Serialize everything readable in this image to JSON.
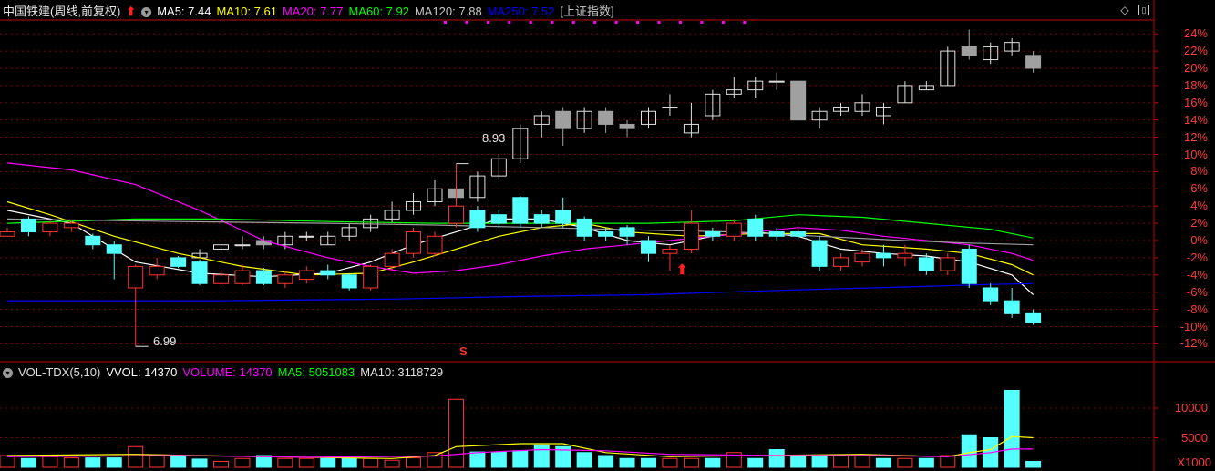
{
  "main_header": {
    "title": "中国铁建(周线,前复权)",
    "ma5_label": "MA5: 7.44",
    "ma10_label": "MA10: 7.61",
    "ma20_label": "MA20: 7.77",
    "ma60_label": "MA60: 7.92",
    "ma120_label": "MA120: 7.88",
    "ma250_label": "MA250: 7.52",
    "index_label": "[上证指数]"
  },
  "vol_header": {
    "title": "VOL-TDX(5,10)",
    "vvol_label": "VVOL: 14370",
    "volume_label": "VOLUME: 14370",
    "ma5_label": "MA5: 5051083",
    "ma10_label": "MA10: 3118729"
  },
  "price_axis_ticks": [
    "24%",
    "22%",
    "20%",
    "18%",
    "16%",
    "14%",
    "12%",
    "10%",
    "8%",
    "6%",
    "4%",
    "2%",
    "0%",
    "-2%",
    "-4%",
    "-6%",
    "-8%",
    "-10%",
    "-12%"
  ],
  "volume_axis_ticks": [
    "10000",
    "5000"
  ],
  "volume_unit": "X1000",
  "annotations": {
    "high": "8.93",
    "low": "6.99",
    "s_marker": "S"
  },
  "colors": {
    "up": "#ff3232",
    "down": "#54ffff",
    "index_up": "#e0e0e0",
    "index_down": "#a0a0a0",
    "ma5": "#ffffff",
    "ma10": "#ffff00",
    "ma20": "#ff00ff",
    "ma60": "#00ff00",
    "ma120": "#a0a0a0",
    "ma250": "#0000ff",
    "grid": "#800000",
    "axis": "#c00000"
  },
  "chart_data": {
    "type": "candlestick",
    "y_axis": "percent change",
    "ylim": [
      -13,
      25
    ],
    "stock_candles": [
      {
        "o": 0.5,
        "c": 1.0,
        "h": 1.5,
        "l": 0.5
      },
      {
        "o": 2.5,
        "c": 1.0,
        "h": 2.8,
        "l": 0.5
      },
      {
        "o": 1.0,
        "c": 2.0,
        "h": 2.3,
        "l": 0.5
      },
      {
        "o": 1.5,
        "c": 2.0,
        "h": 2.4,
        "l": 1.0
      },
      {
        "o": 0.5,
        "c": -0.5,
        "h": 0.8,
        "l": -1.0
      },
      {
        "o": -0.5,
        "c": -1.5,
        "h": 0.0,
        "l": -4.5
      },
      {
        "o": -5.5,
        "c": -3.0,
        "h": -2.8,
        "l": -12.3
      },
      {
        "o": -4.0,
        "c": -3.0,
        "h": -2.0,
        "l": -4.5
      },
      {
        "o": -2.0,
        "c": -3.0,
        "h": -1.8,
        "l": -3.2
      },
      {
        "o": -2.5,
        "c": -5.0,
        "h": -2.2,
        "l": -5.2
      },
      {
        "o": -5.0,
        "c": -4.0,
        "h": -3.5,
        "l": -5.2
      },
      {
        "o": -5.0,
        "c": -3.5,
        "h": -2.8,
        "l": -5.2
      },
      {
        "o": -3.5,
        "c": -5.0,
        "h": -3.2,
        "l": -5.2
      },
      {
        "o": -5.0,
        "c": -4.0,
        "h": -3.5,
        "l": -5.5
      },
      {
        "o": -4.5,
        "c": -3.5,
        "h": -3.0,
        "l": -5.0
      },
      {
        "o": -3.5,
        "c": -4.0,
        "h": -2.8,
        "l": -4.5
      },
      {
        "o": -4.0,
        "c": -5.5,
        "h": -3.8,
        "l": -5.8
      },
      {
        "o": -5.5,
        "c": -3.0,
        "h": -2.8,
        "l": -5.8
      },
      {
        "o": -3.0,
        "c": -1.5,
        "h": -1.0,
        "l": -3.5
      },
      {
        "o": -1.5,
        "c": 1.0,
        "h": 1.5,
        "l": -2.0
      },
      {
        "o": -1.5,
        "c": 0.5,
        "h": 1.0,
        "l": -1.8
      },
      {
        "o": 2.0,
        "c": 4.0,
        "h": 8.93,
        "l": 1.5
      },
      {
        "o": 3.5,
        "c": 1.5,
        "h": 4.0,
        "l": 1.0
      },
      {
        "o": 3.0,
        "c": 2.0,
        "h": 3.5,
        "l": 1.5
      },
      {
        "o": 5.0,
        "c": 2.0,
        "h": 5.2,
        "l": 1.5
      },
      {
        "o": 3.0,
        "c": 2.0,
        "h": 3.5,
        "l": 1.5
      },
      {
        "o": 3.5,
        "c": 2.0,
        "h": 5.0,
        "l": 1.5
      },
      {
        "o": 2.5,
        "c": 0.5,
        "h": 2.8,
        "l": 0.0
      },
      {
        "o": 1.0,
        "c": 0.5,
        "h": 1.5,
        "l": 0.0
      },
      {
        "o": 1.5,
        "c": 0.5,
        "h": 1.8,
        "l": -0.5
      },
      {
        "o": 0.0,
        "c": -1.5,
        "h": 0.5,
        "l": -2.5
      },
      {
        "o": -1.5,
        "c": -1.0,
        "h": -0.5,
        "l": -3.5
      },
      {
        "o": -1.0,
        "c": 2.0,
        "h": 3.5,
        "l": -1.5
      },
      {
        "o": 1.0,
        "c": 0.5,
        "h": 1.5,
        "l": 0.0
      },
      {
        "o": 0.5,
        "c": 2.0,
        "h": 2.5,
        "l": 0.0
      },
      {
        "o": 2.5,
        "c": 0.5,
        "h": 3.0,
        "l": 0.0
      },
      {
        "o": 1.0,
        "c": 0.5,
        "h": 1.5,
        "l": 0.0
      },
      {
        "o": 1.0,
        "c": 0.5,
        "h": 1.3,
        "l": 0.2
      },
      {
        "o": 0.0,
        "c": -3.0,
        "h": 0.5,
        "l": -3.5
      },
      {
        "o": -3.0,
        "c": -2.0,
        "h": -1.5,
        "l": -3.5
      },
      {
        "o": -2.5,
        "c": -1.5,
        "h": -1.0,
        "l": -3.0
      },
      {
        "o": -1.5,
        "c": -2.0,
        "h": -0.5,
        "l": -3.0
      },
      {
        "o": -2.0,
        "c": -1.5,
        "h": -0.5,
        "l": -3.0
      },
      {
        "o": -2.0,
        "c": -3.5,
        "h": -1.5,
        "l": -4.0
      },
      {
        "o": -3.5,
        "c": -2.0,
        "h": -1.5,
        "l": -4.0
      },
      {
        "o": -1.0,
        "c": -5.0,
        "h": -0.5,
        "l": -5.5
      },
      {
        "o": -5.5,
        "c": -7.0,
        "h": -5.0,
        "l": -7.5
      },
      {
        "o": -7.0,
        "c": -8.5,
        "h": -5.5,
        "l": -9.0
      },
      {
        "o": -8.5,
        "c": -9.5,
        "h": -8.0,
        "l": -9.8
      }
    ],
    "index_candles": [
      {
        "i": 9,
        "o": -2.0,
        "c": -1.5,
        "h": -1.0,
        "l": -2.0
      },
      {
        "i": 10,
        "o": -1.0,
        "c": -0.5,
        "h": 0.0,
        "l": -1.5
      },
      {
        "i": 11,
        "o": -0.5,
        "c": -0.5,
        "h": 0.5,
        "l": -1.0
      },
      {
        "i": 12,
        "o": 0.0,
        "c": -0.5,
        "h": 0.5,
        "l": -1.0
      },
      {
        "i": 13,
        "o": -0.5,
        "c": 0.5,
        "h": 1.0,
        "l": -1.0
      },
      {
        "i": 14,
        "o": 0.5,
        "c": 0.5,
        "h": 1.0,
        "l": 0.0
      },
      {
        "i": 15,
        "o": -0.5,
        "c": 0.5,
        "h": 1.0,
        "l": -0.5
      },
      {
        "i": 16,
        "o": 0.5,
        "c": 1.5,
        "h": 2.0,
        "l": 0.0
      },
      {
        "i": 17,
        "o": 1.5,
        "c": 2.5,
        "h": 3.0,
        "l": 1.0
      },
      {
        "i": 18,
        "o": 2.5,
        "c": 3.5,
        "h": 4.5,
        "l": 2.0
      },
      {
        "i": 19,
        "o": 3.5,
        "c": 4.5,
        "h": 5.5,
        "l": 3.0
      },
      {
        "i": 20,
        "o": 4.5,
        "c": 6.0,
        "h": 7.0,
        "l": 4.0
      },
      {
        "i": 21,
        "o": 6.0,
        "c": 5.0,
        "h": 6.5,
        "l": 4.5
      },
      {
        "i": 22,
        "o": 5.0,
        "c": 7.5,
        "h": 8.0,
        "l": 4.5
      },
      {
        "i": 23,
        "o": 7.5,
        "c": 9.5,
        "h": 10.0,
        "l": 7.0
      },
      {
        "i": 24,
        "o": 9.5,
        "c": 13.0,
        "h": 13.5,
        "l": 9.0
      },
      {
        "i": 25,
        "o": 13.5,
        "c": 14.5,
        "h": 15.0,
        "l": 12.0
      },
      {
        "i": 26,
        "o": 15.0,
        "c": 13.0,
        "h": 15.5,
        "l": 11.0
      },
      {
        "i": 27,
        "o": 13.0,
        "c": 15.0,
        "h": 15.5,
        "l": 12.5
      },
      {
        "i": 28,
        "o": 15.0,
        "c": 13.5,
        "h": 15.5,
        "l": 12.5
      },
      {
        "i": 29,
        "o": 13.5,
        "c": 13.0,
        "h": 14.0,
        "l": 12.0
      },
      {
        "i": 30,
        "o": 13.5,
        "c": 15.0,
        "h": 15.5,
        "l": 13.0
      },
      {
        "i": 31,
        "o": 15.5,
        "c": 15.5,
        "h": 17.0,
        "l": 14.5
      },
      {
        "i": 32,
        "o": 12.5,
        "c": 13.5,
        "h": 16.0,
        "l": 12.0
      },
      {
        "i": 33,
        "o": 14.5,
        "c": 17.0,
        "h": 17.5,
        "l": 14.0
      },
      {
        "i": 34,
        "o": 17.0,
        "c": 17.5,
        "h": 19.0,
        "l": 16.5
      },
      {
        "i": 35,
        "o": 17.5,
        "c": 18.5,
        "h": 19.0,
        "l": 16.5
      },
      {
        "i": 36,
        "o": 18.5,
        "c": 18.5,
        "h": 19.5,
        "l": 17.5
      },
      {
        "i": 37,
        "o": 18.5,
        "c": 14.0,
        "h": 18.5,
        "l": 14.0
      },
      {
        "i": 38,
        "o": 14.0,
        "c": 15.0,
        "h": 15.5,
        "l": 13.0
      },
      {
        "i": 39,
        "o": 15.0,
        "c": 15.5,
        "h": 16.0,
        "l": 14.5
      },
      {
        "i": 40,
        "o": 15.0,
        "c": 16.0,
        "h": 17.0,
        "l": 14.5
      },
      {
        "i": 41,
        "o": 14.5,
        "c": 15.5,
        "h": 16.0,
        "l": 13.5
      },
      {
        "i": 42,
        "o": 16.0,
        "c": 18.0,
        "h": 18.5,
        "l": 16.0
      },
      {
        "i": 43,
        "o": 17.5,
        "c": 18.0,
        "h": 18.5,
        "l": 17.5
      },
      {
        "i": 44,
        "o": 18.0,
        "c": 22.0,
        "h": 22.5,
        "l": 18.0
      },
      {
        "i": 45,
        "o": 22.5,
        "c": 21.5,
        "h": 24.5,
        "l": 21.0
      },
      {
        "i": 46,
        "o": 21.0,
        "c": 22.5,
        "h": 23.0,
        "l": 20.5
      },
      {
        "i": 47,
        "o": 22.0,
        "c": 23.0,
        "h": 23.5,
        "l": 21.5
      },
      {
        "i": 48,
        "o": 21.5,
        "c": 20.0,
        "h": 22.0,
        "l": 19.5
      }
    ],
    "ma_lines": [
      {
        "name": "MA5",
        "color": "#ffffff",
        "points": [
          [
            0,
            3.5
          ],
          [
            3,
            2.0
          ],
          [
            6,
            -2.5
          ],
          [
            9,
            -3.8
          ],
          [
            12,
            -4.2
          ],
          [
            15,
            -3.8
          ],
          [
            17,
            -2.5
          ],
          [
            19,
            -0.5
          ],
          [
            21,
            1.0
          ],
          [
            23,
            2.5
          ],
          [
            25,
            2.5
          ],
          [
            27,
            1.5
          ],
          [
            29,
            0.0
          ],
          [
            31,
            -0.5
          ],
          [
            33,
            0.5
          ],
          [
            35,
            1.0
          ],
          [
            37,
            0.5
          ],
          [
            39,
            -1.0
          ],
          [
            41,
            -1.5
          ],
          [
            43,
            -1.8
          ],
          [
            45,
            -2.5
          ],
          [
            47,
            -4.0
          ],
          [
            48,
            -6.3
          ]
        ]
      },
      {
        "name": "MA10",
        "color": "#ffff00",
        "points": [
          [
            0,
            4.5
          ],
          [
            2,
            3.0
          ],
          [
            5,
            0.5
          ],
          [
            8,
            -1.5
          ],
          [
            11,
            -3.0
          ],
          [
            14,
            -4.0
          ],
          [
            17,
            -3.8
          ],
          [
            19,
            -2.5
          ],
          [
            21,
            -1.0
          ],
          [
            23,
            0.5
          ],
          [
            25,
            1.5
          ],
          [
            27,
            2.0
          ],
          [
            29,
            1.0
          ],
          [
            32,
            0.5
          ],
          [
            35,
            0.8
          ],
          [
            38,
            0.8
          ],
          [
            40,
            -0.5
          ],
          [
            43,
            -1.0
          ],
          [
            45,
            -1.5
          ],
          [
            47,
            -2.8
          ],
          [
            48,
            -4.0
          ]
        ]
      },
      {
        "name": "MA20",
        "color": "#ff00ff",
        "points": [
          [
            0,
            9.0
          ],
          [
            3,
            8.2
          ],
          [
            6,
            6.5
          ],
          [
            9,
            3.5
          ],
          [
            12,
            0.0
          ],
          [
            15,
            -2.0
          ],
          [
            17,
            -3.0
          ],
          [
            19,
            -3.8
          ],
          [
            21,
            -3.5
          ],
          [
            23,
            -2.8
          ],
          [
            25,
            -1.8
          ],
          [
            27,
            -1.0
          ],
          [
            29,
            -0.5
          ],
          [
            31,
            0.0
          ],
          [
            33,
            0.5
          ],
          [
            35,
            1.0
          ],
          [
            37,
            1.5
          ],
          [
            39,
            1.2
          ],
          [
            41,
            0.5
          ],
          [
            43,
            0.0
          ],
          [
            45,
            -0.5
          ],
          [
            47,
            -1.5
          ],
          [
            48,
            -2.3
          ]
        ]
      },
      {
        "name": "MA60",
        "color": "#00ff00",
        "points": [
          [
            0,
            2.0
          ],
          [
            6,
            2.5
          ],
          [
            10,
            2.5
          ],
          [
            15,
            2.2
          ],
          [
            20,
            2.0
          ],
          [
            25,
            2.0
          ],
          [
            30,
            2.0
          ],
          [
            34,
            2.3
          ],
          [
            37,
            3.0
          ],
          [
            40,
            2.7
          ],
          [
            43,
            2.0
          ],
          [
            46,
            1.3
          ],
          [
            48,
            0.3
          ]
        ]
      },
      {
        "name": "MA120",
        "color": "#a0a0a0",
        "points": [
          [
            0,
            2.5
          ],
          [
            8,
            2.2
          ],
          [
            15,
            2.0
          ],
          [
            20,
            1.8
          ],
          [
            25,
            1.5
          ],
          [
            30,
            1.2
          ],
          [
            34,
            1.0
          ],
          [
            38,
            0.5
          ],
          [
            42,
            0.0
          ],
          [
            45,
            -0.3
          ],
          [
            48,
            -0.5
          ]
        ]
      },
      {
        "name": "MA250",
        "color": "#0000ff",
        "points": [
          [
            0,
            -7.0
          ],
          [
            10,
            -7.0
          ],
          [
            18,
            -6.8
          ],
          [
            24,
            -6.5
          ],
          [
            30,
            -6.3
          ],
          [
            36,
            -5.8
          ],
          [
            42,
            -5.4
          ],
          [
            46,
            -5.1
          ],
          [
            48,
            -5.0
          ]
        ]
      }
    ],
    "volume_ylim": [
      0,
      14000
    ],
    "volume_bars": [
      2000,
      1500,
      1800,
      1600,
      1600,
      1600,
      3500,
      2000,
      2000,
      1400,
      1000,
      1500,
      2000,
      1500,
      1500,
      1500,
      1500,
      1500,
      1200,
      1600,
      2500,
      11500,
      2600,
      2600,
      2800,
      3800,
      3500,
      2500,
      2000,
      1500,
      1500,
      1500,
      1500,
      1500,
      2500,
      1500,
      3000,
      2000,
      2000,
      2000,
      2000,
      1500,
      1500,
      1500,
      2000,
      5500,
      5000,
      13000,
      1000
    ],
    "volume_ma": [
      {
        "name": "MA5",
        "color": "#ffff00",
        "points": [
          [
            0,
            2000
          ],
          [
            6,
            2200
          ],
          [
            12,
            1800
          ],
          [
            18,
            1500
          ],
          [
            20,
            2000
          ],
          [
            21,
            3500
          ],
          [
            24,
            4000
          ],
          [
            26,
            4000
          ],
          [
            28,
            2500
          ],
          [
            31,
            1800
          ],
          [
            35,
            2000
          ],
          [
            40,
            2200
          ],
          [
            44,
            1800
          ],
          [
            45,
            2500
          ],
          [
            46,
            3000
          ],
          [
            47,
            5200
          ],
          [
            48,
            5000
          ]
        ]
      },
      {
        "name": "MA10",
        "color": "#ff00ff",
        "points": [
          [
            0,
            1800
          ],
          [
            8,
            2000
          ],
          [
            14,
            1700
          ],
          [
            20,
            1900
          ],
          [
            22,
            2500
          ],
          [
            25,
            3000
          ],
          [
            28,
            2800
          ],
          [
            31,
            2200
          ],
          [
            36,
            2000
          ],
          [
            41,
            2000
          ],
          [
            44,
            1800
          ],
          [
            46,
            2500
          ],
          [
            47,
            3100
          ],
          [
            48,
            3100
          ]
        ]
      }
    ]
  }
}
